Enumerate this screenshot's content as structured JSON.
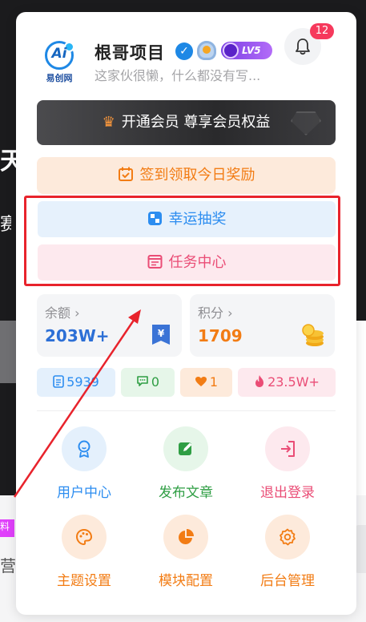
{
  "profile": {
    "logo_text": "Ai",
    "logo_subtext": "易创网",
    "name": "根哥项目",
    "level": "LV5",
    "bio": "这家伙很懒，什么都没有写..."
  },
  "notifications": {
    "count": "12"
  },
  "vip": {
    "label": "开通会员 尊享会员权益"
  },
  "checkin": {
    "label": "签到领取今日奖励"
  },
  "actions": {
    "lottery": "幸运抽奖",
    "tasks": "任务中心"
  },
  "balance": {
    "label": "余额",
    "value": "203W+"
  },
  "points": {
    "label": "积分",
    "value": "1709"
  },
  "chips": {
    "posts": "5939",
    "comments": "0",
    "likes": "1",
    "heat": "23.5W+"
  },
  "menu": {
    "user_center": "用户中心",
    "publish": "发布文章",
    "logout": "退出登录",
    "theme": "主题设置",
    "modules": "模块配置",
    "admin": "后台管理"
  },
  "colors": {
    "accent_blue": "#2c8df0",
    "accent_orange": "#f27c14",
    "accent_pink": "#ea4d76",
    "accent_green": "#2f9e44",
    "highlight_red": "#e8232c",
    "badge_red": "#f6395c"
  }
}
